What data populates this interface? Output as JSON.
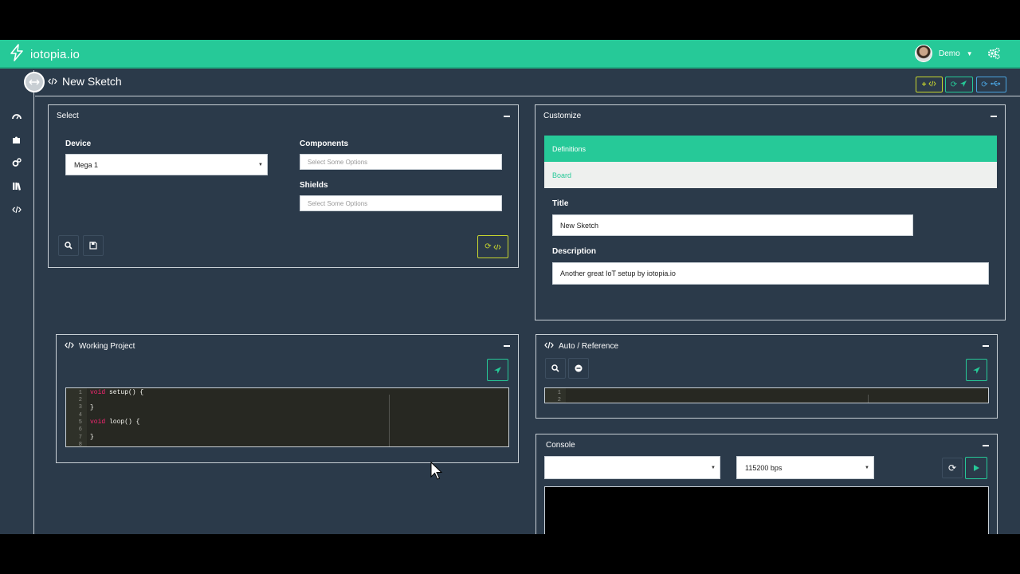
{
  "brand": {
    "name": "iotopia.io",
    "accent": "#26c998",
    "background": "#2b3a4a"
  },
  "user": {
    "name": "Demo"
  },
  "sidebar": {
    "items": [
      {
        "icon": "dashboard-icon"
      },
      {
        "icon": "puzzle-icon"
      },
      {
        "icon": "gears-icon"
      },
      {
        "icon": "library-icon"
      },
      {
        "icon": "code-icon"
      }
    ]
  },
  "page": {
    "title": "New Sketch"
  },
  "select_panel": {
    "title": "Select",
    "device_label": "Device",
    "device_value": "Mega 1",
    "components_label": "Components",
    "components_placeholder": "Select Some Options",
    "shields_label": "Shields",
    "shields_placeholder": "Select Some Options"
  },
  "customize_panel": {
    "title": "Customize",
    "tabs": [
      "Definitions",
      "Board"
    ],
    "title_label": "Title",
    "title_value": "New Sketch",
    "description_label": "Description",
    "description_value": "Another great IoT setup by iotopia.io"
  },
  "working_project": {
    "title": "Working Project",
    "line_numbers": [
      "1",
      "2",
      "3",
      "4",
      "5",
      "6",
      "7",
      "8"
    ],
    "code": [
      "void setup() {",
      "",
      "}",
      "",
      "void loop() {",
      "",
      "}",
      ""
    ]
  },
  "auto_reference": {
    "title": "Auto / Reference",
    "line_numbers": [
      "1",
      "2"
    ]
  },
  "console": {
    "title": "Console",
    "port_value": "",
    "baud_value": "115200 bps"
  }
}
